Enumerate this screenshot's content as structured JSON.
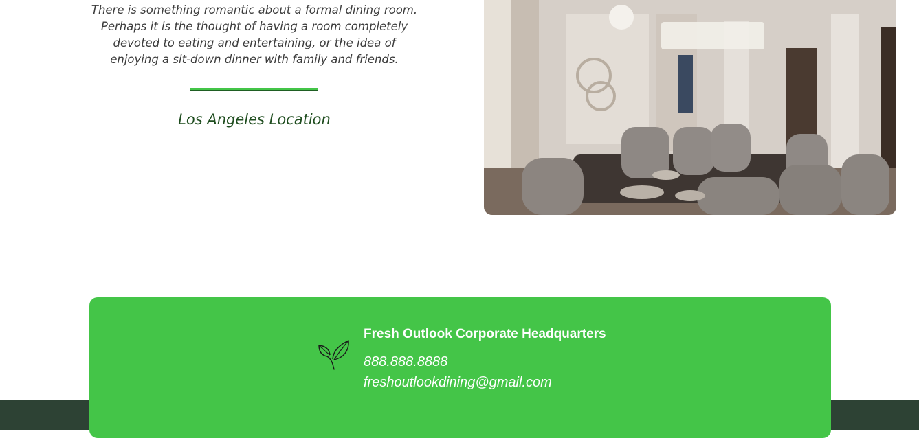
{
  "intro": {
    "text": "There is something romantic about a formal dining room. Perhaps it is the thought of having a room completely devoted to eating and entertaining, or the idea of enjoying a sit-down dinner with family and friends."
  },
  "location": {
    "title": "Los Angeles Location"
  },
  "contact": {
    "title": "Fresh Outlook Corporate Headquarters",
    "phone": "888.888.8888",
    "email": "freshoutlookdining@gmail.com",
    "icon": "leaf-icon"
  },
  "colors": {
    "accent_green": "#44c548",
    "footer_dark": "#2d4234",
    "location_text": "#1f4d1f"
  }
}
